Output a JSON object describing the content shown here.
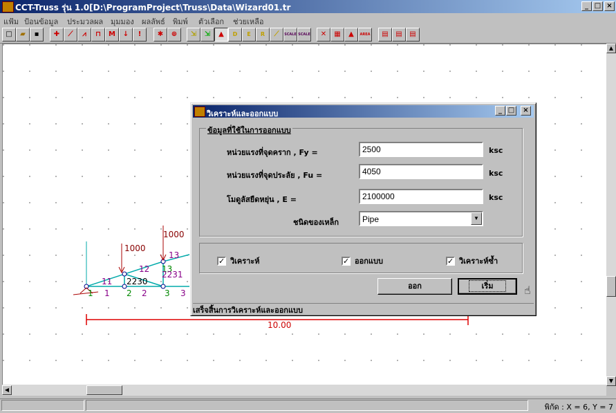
{
  "window": {
    "title": "CCT-Truss รุ่น 1.0[D:\\ProgramProject\\Truss\\Data\\Wizard01.tr",
    "minimize": "_",
    "maximize": "□",
    "close": "×"
  },
  "menu": [
    "แฟ้ม",
    "ป้อนข้อมูล",
    "ประมวลผล",
    "มุมมอง",
    "ผลลัพธ์",
    "พิมพ์",
    "ตัวเลือก",
    "ช่วยเหลือ"
  ],
  "toolbar": {
    "m_label": "M",
    "scale1": "SCALE",
    "scale2": "SCALE",
    "d_label": "D",
    "e_label": "E",
    "r_label": "R",
    "area_label": "AREA"
  },
  "drawing": {
    "loads": [
      "1000",
      "1000"
    ],
    "member_labels": [
      "13",
      "12",
      "11",
      "13",
      "2231",
      "2230"
    ],
    "node_labels": [
      "1",
      "1",
      "2",
      "2",
      "3",
      "3"
    ],
    "dimension": "10.00"
  },
  "dialog": {
    "title": "วิเคราะห์และออกแบบ",
    "group_title": "ข้อมูลที่ใช้ในการออกแบบ",
    "fields": [
      {
        "label": "หน่วยแรงที่จุดคราก   , Fy =",
        "value": "2500",
        "unit": "ksc"
      },
      {
        "label": "หน่วยแรงที่จุดประลัย  , Fu =",
        "value": "4050",
        "unit": "ksc"
      },
      {
        "label": "โมดูลัสยืดหยุ่น           , E =",
        "value": "2100000",
        "unit": "ksc"
      }
    ],
    "steel_type_label": "ชนิดของเหล็ก",
    "steel_type_value": "Pipe",
    "checkboxes": [
      {
        "label": "วิเคราะห์",
        "checked": true
      },
      {
        "label": "ออกแบบ",
        "checked": true
      },
      {
        "label": "วิเคราะห์ซ้ำ",
        "checked": true
      }
    ],
    "exit_button": "ออก",
    "start_button": "เริ่ม",
    "status": "เสร็จสิ้นการวิเคราะห์และออกแบบ"
  },
  "status": {
    "coords": "พิกัด : X = 6, Y = 7"
  }
}
